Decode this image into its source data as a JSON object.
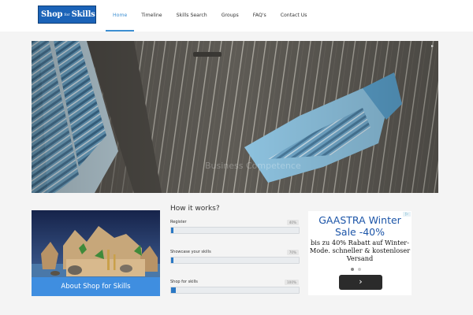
{
  "logo": {
    "shop": "Shop",
    "for": "for",
    "skills": "Skills"
  },
  "nav": [
    {
      "label": "Home",
      "active": true
    },
    {
      "label": "Timeline",
      "active": false
    },
    {
      "label": "Skills Search",
      "active": false
    },
    {
      "label": "Groups",
      "active": false
    },
    {
      "label": "FAQ's",
      "active": false
    },
    {
      "label": "Contact Us",
      "active": false
    }
  ],
  "hero": {
    "caption": "Business Competence"
  },
  "about": {
    "label": "About Shop for Skills"
  },
  "how": {
    "title": "How it works?",
    "steps": [
      {
        "label": "Register",
        "percent_text": "40%",
        "progress": 0.02
      },
      {
        "label": "Showcase your skills",
        "percent_text": "70%",
        "progress": 0.02
      },
      {
        "label": "Shop for skills",
        "percent_text": "100%",
        "progress": 0.04
      }
    ]
  },
  "ad": {
    "title": "GAASTRA Winter Sale -40%",
    "body": "bis zu 40% Rabatt auf Winter-Mode. schneller & kostenloser Versand",
    "button_icon": "chevron-right-icon",
    "badge_icon": "adchoices-icon"
  },
  "colors": {
    "accent": "#3d8fd2",
    "about_bar": "#3f8ee0",
    "progress_fill": "#2a78c4"
  }
}
